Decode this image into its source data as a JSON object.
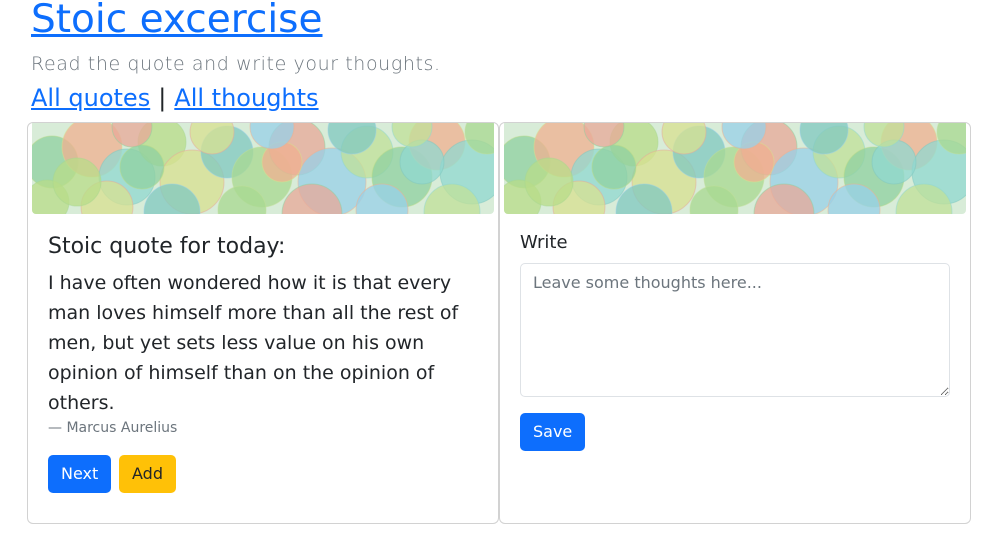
{
  "header": {
    "title": "Stoic excercise",
    "lead": "Read the quote and write your thoughts.",
    "nav": {
      "all_quotes": "All quotes",
      "separator": "|",
      "all_thoughts": "All thoughts"
    }
  },
  "quote_card": {
    "title": "Stoic quote for today:",
    "quote": "I have often wondered how it is that every man loves himself more than all the rest of men, but yet sets less value on his own opinion of himself than on the opinion of others.",
    "author": "—  Marcus Aurelius",
    "next_label": "Next",
    "add_label": "Add"
  },
  "write_card": {
    "label": "Write",
    "placeholder": "Leave some thoughts here...",
    "value": "",
    "save_label": "Save"
  },
  "colors": {
    "link": "#0d6efd",
    "primary": "#0d6efd",
    "warning": "#ffc107",
    "muted": "#6c757d"
  }
}
